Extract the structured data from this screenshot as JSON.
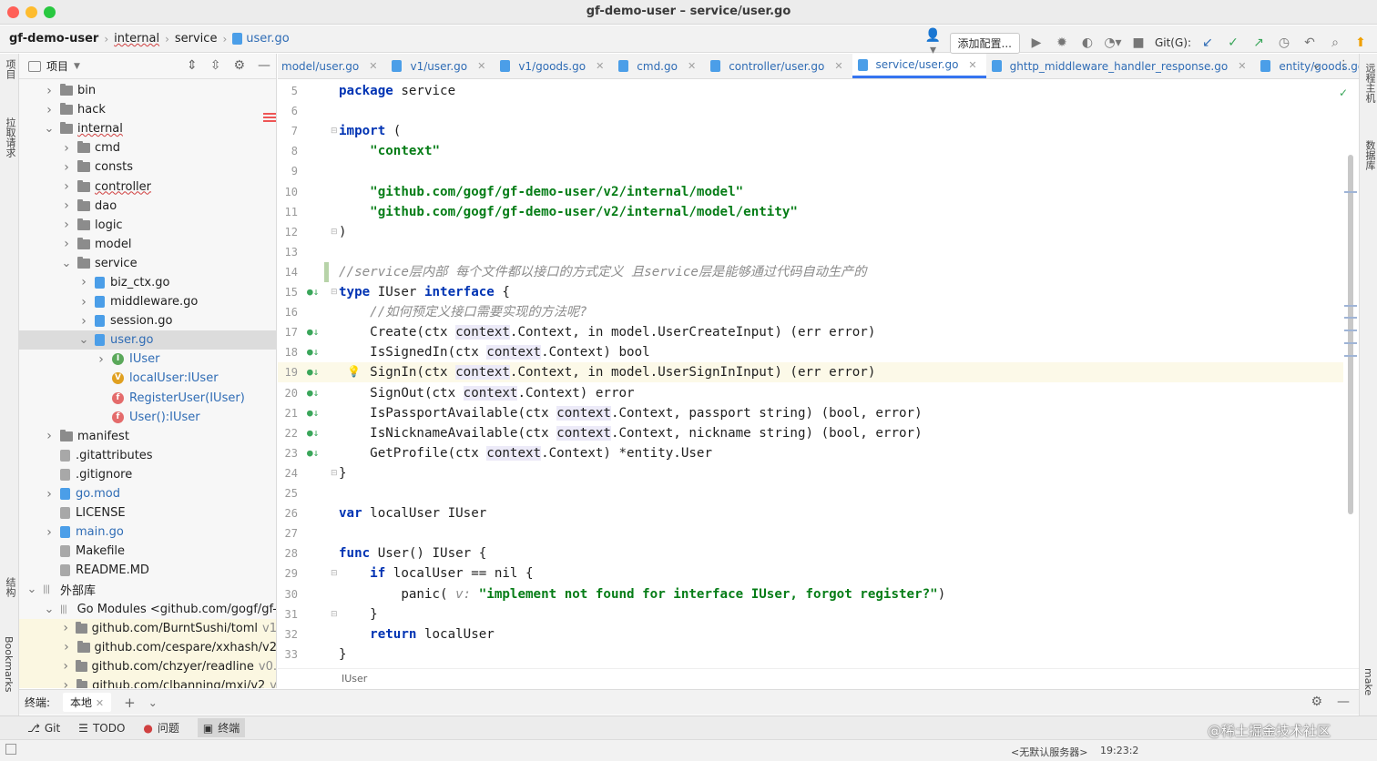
{
  "window": {
    "title": "gf-demo-user – service/user.go"
  },
  "breadcrumbs": [
    {
      "label": "gf-demo-user"
    },
    {
      "label": "internal"
    },
    {
      "label": "service"
    },
    {
      "label": "user.go"
    }
  ],
  "nav": {
    "config_button": "添加配置...",
    "git_label": "Git(G):"
  },
  "left_strip": {
    "project": "项目",
    "pull_requests": "拉取请求",
    "structure": "结构",
    "bookmarks": "Bookmarks"
  },
  "right_strip": {
    "remote": "远程主机",
    "database": "数据库",
    "make": "make"
  },
  "project_panel": {
    "header": "项目",
    "tree": [
      {
        "label": "bin",
        "kind": "folder",
        "depth": 1,
        "arrow": "right"
      },
      {
        "label": "hack",
        "kind": "folder",
        "depth": 1,
        "arrow": "right"
      },
      {
        "label": "internal",
        "kind": "folder",
        "depth": 1,
        "arrow": "down",
        "squiggle": true
      },
      {
        "label": "cmd",
        "kind": "folder",
        "depth": 2,
        "arrow": "right"
      },
      {
        "label": "consts",
        "kind": "folder",
        "depth": 2,
        "arrow": "right"
      },
      {
        "label": "controller",
        "kind": "folder",
        "depth": 2,
        "arrow": "right",
        "squiggle": true
      },
      {
        "label": "dao",
        "kind": "folder",
        "depth": 2,
        "arrow": "right"
      },
      {
        "label": "logic",
        "kind": "folder",
        "depth": 2,
        "arrow": "right"
      },
      {
        "label": "model",
        "kind": "folder",
        "depth": 2,
        "arrow": "right"
      },
      {
        "label": "service",
        "kind": "folder",
        "depth": 2,
        "arrow": "down"
      },
      {
        "label": "biz_ctx.go",
        "kind": "gofile",
        "depth": 3,
        "arrow": "right"
      },
      {
        "label": "middleware.go",
        "kind": "gofile",
        "depth": 3,
        "arrow": "right"
      },
      {
        "label": "session.go",
        "kind": "gofile",
        "depth": 3,
        "arrow": "right"
      },
      {
        "label": "user.go",
        "kind": "gofile",
        "depth": 3,
        "arrow": "down",
        "selected": true,
        "blue": true
      },
      {
        "label": "IUser",
        "kind": "interface",
        "depth": 4,
        "arrow": "right",
        "blue": true
      },
      {
        "label": "localUser:IUser",
        "kind": "variable",
        "depth": 4,
        "arrow": "",
        "blue": true
      },
      {
        "label": "RegisterUser(IUser)",
        "kind": "function",
        "depth": 4,
        "arrow": "",
        "blue": true
      },
      {
        "label": "User():IUser",
        "kind": "function",
        "depth": 4,
        "arrow": "",
        "blue": true
      },
      {
        "label": "manifest",
        "kind": "folder",
        "depth": 1,
        "arrow": "right"
      },
      {
        "label": ".gitattributes",
        "kind": "file",
        "depth": 1,
        "arrow": ""
      },
      {
        "label": ".gitignore",
        "kind": "file",
        "depth": 1,
        "arrow": ""
      },
      {
        "label": "go.mod",
        "kind": "gofile",
        "depth": 1,
        "arrow": "right",
        "blue": true
      },
      {
        "label": "LICENSE",
        "kind": "file",
        "depth": 1,
        "arrow": ""
      },
      {
        "label": "main.go",
        "kind": "gofile",
        "depth": 1,
        "arrow": "right",
        "blue": true
      },
      {
        "label": "Makefile",
        "kind": "file",
        "depth": 1,
        "arrow": ""
      },
      {
        "label": "README.MD",
        "kind": "file",
        "depth": 1,
        "arrow": ""
      },
      {
        "label": "外部库",
        "kind": "libs",
        "depth": 0,
        "arrow": "down"
      },
      {
        "label": "Go Modules <github.com/gogf/gf-",
        "kind": "libs",
        "depth": 1,
        "arrow": "down"
      },
      {
        "label": "github.com/BurntSushi/toml",
        "suffix": "v1",
        "kind": "folder",
        "depth": 2,
        "arrow": "right",
        "lib": true
      },
      {
        "label": "github.com/cespare/xxhash/v2",
        "suffix": "",
        "kind": "folder",
        "depth": 2,
        "arrow": "right",
        "lib": true
      },
      {
        "label": "github.com/chzyer/readline",
        "suffix": "v0.",
        "kind": "folder",
        "depth": 2,
        "arrow": "right",
        "lib": true
      },
      {
        "label": "github.com/clbanning/mxj/v2",
        "suffix": "v",
        "kind": "folder",
        "depth": 2,
        "arrow": "right",
        "lib": true
      }
    ]
  },
  "tabs": [
    {
      "label": "model/user.go",
      "active": false
    },
    {
      "label": "v1/user.go",
      "active": false
    },
    {
      "label": "v1/goods.go",
      "active": false
    },
    {
      "label": "cmd.go",
      "active": false
    },
    {
      "label": "controller/user.go",
      "active": false
    },
    {
      "label": "service/user.go",
      "active": true
    },
    {
      "label": "ghttp_middleware_handler_response.go",
      "active": false
    },
    {
      "label": "entity/goods.go",
      "active": false
    }
  ],
  "editor": {
    "lines": [
      {
        "n": "5",
        "html": "<span class='kw'>package</span> service"
      },
      {
        "n": "6",
        "html": ""
      },
      {
        "n": "7",
        "html": "<span class='kw'>import</span> (",
        "fold": true
      },
      {
        "n": "8",
        "html": "    <span class='str'>\"context\"</span>"
      },
      {
        "n": "9",
        "html": ""
      },
      {
        "n": "10",
        "html": "    <span class='str'>\"github.com/gogf/gf-demo-user/v2/internal/model\"</span>"
      },
      {
        "n": "11",
        "html": "    <span class='str'>\"github.com/gogf/gf-demo-user/v2/internal/model/entity\"</span>"
      },
      {
        "n": "12",
        "html": ")",
        "fold": true
      },
      {
        "n": "13",
        "html": ""
      },
      {
        "n": "14",
        "html": "<span class='cm'>//service层内部 每个文件都以接口的方式定义 且service层是能够通过代码自动生产的</span>",
        "vcs": true
      },
      {
        "n": "15",
        "html": "<span class='kw'>type</span> IUser <span class='kw'>interface</span> {",
        "mark": "●↓",
        "fold": true
      },
      {
        "n": "16",
        "html": "    <span class='cm'>//如何预定义接口需要实现的方法呢?</span>"
      },
      {
        "n": "17",
        "html": "    Create(ctx <span class='pk'>context</span>.Context, in model.UserCreateInput) (err error)",
        "mark": "●↓"
      },
      {
        "n": "18",
        "html": "    IsSignedIn(ctx <span class='pk'>context</span>.Context) bool",
        "mark": "●↓"
      },
      {
        "n": "19",
        "html": "    SignIn(ctx <span class='pk'>context</span>.Context, in model.UserSignInInput) (err error)",
        "mark": "●↓",
        "current": true,
        "bulb": true
      },
      {
        "n": "20",
        "html": "    SignOut(ctx <span class='pk'>context</span>.Context) error",
        "mark": "●↓"
      },
      {
        "n": "21",
        "html": "    IsPassportAvailable(ctx <span class='pk'>context</span>.Context, passport string) (bool, error)",
        "mark": "●↓"
      },
      {
        "n": "22",
        "html": "    IsNicknameAvailable(ctx <span class='pk'>context</span>.Context, nickname string) (bool, error)",
        "mark": "●↓"
      },
      {
        "n": "23",
        "html": "    GetProfile(ctx <span class='pk'>context</span>.Context) *entity.User",
        "mark": "●↓"
      },
      {
        "n": "24",
        "html": "}",
        "fold": true
      },
      {
        "n": "25",
        "html": ""
      },
      {
        "n": "26",
        "html": "<span class='kw'>var</span> localUser IUser"
      },
      {
        "n": "27",
        "html": ""
      },
      {
        "n": "28",
        "html": "<span class='kw'>func</span> User() IUser {"
      },
      {
        "n": "29",
        "html": "    <span class='kw'>if</span> localUser == nil {",
        "fold": true
      },
      {
        "n": "30",
        "html": "        panic( <span class='cm'>v:</span> <span class='str'>\"implement not found for interface IUser, forgot register?\"</span>)"
      },
      {
        "n": "31",
        "html": "    }",
        "fold": true
      },
      {
        "n": "32",
        "html": "    <span class='kw'>return</span> localUser"
      },
      {
        "n": "33",
        "html": "}"
      }
    ],
    "footer_crumb": "IUser"
  },
  "terminal": {
    "label": "终端:",
    "tab": "本地"
  },
  "toolwindows": [
    {
      "label": "Git",
      "icon": "⎇"
    },
    {
      "label": "TODO",
      "icon": "☰"
    },
    {
      "label": "问题",
      "icon": "●"
    },
    {
      "label": "终端",
      "icon": "▣",
      "active": true
    }
  ],
  "status": {
    "server": "<无默认服务器>",
    "position": "19:23:2"
  },
  "watermark": "@稀土掘金技术社区"
}
